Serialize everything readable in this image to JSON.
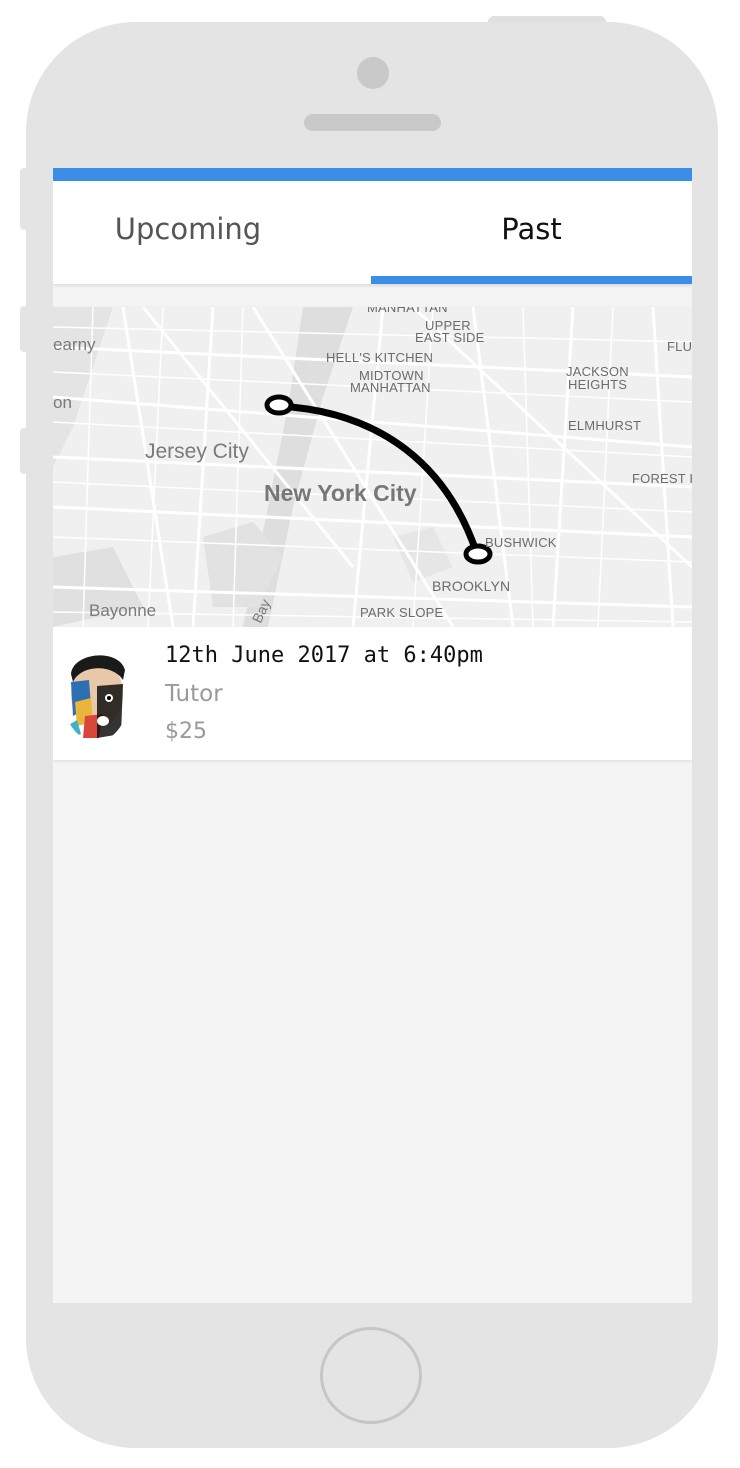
{
  "tabs": [
    {
      "label": "Upcoming",
      "active": false
    },
    {
      "label": "Past",
      "active": true
    }
  ],
  "accent_color": "#3a8ee6",
  "map": {
    "labels": {
      "manhattan": "MANHATTAN",
      "upper_east_side_1": "UPPER",
      "upper_east_side_2": "EAST SIDE",
      "kearny": "earny",
      "hells_kitchen": "HELL'S KITCHEN",
      "midtown_1": "MIDTOWN",
      "midtown_2": "MANHATTAN",
      "jackson_1": "JACKSON",
      "jackson_2": "HEIGHTS",
      "flushing": "FLUS",
      "harrison": "on",
      "jersey_city": "Jersey City",
      "elmhurst": "ELMHURST",
      "new_york_city": "New York City",
      "forest_hills": "FOREST HI",
      "bushwick": "BUSHWICK",
      "brooklyn": "BROOKLYN",
      "bayonne": "Bayonne",
      "bay": "Bay",
      "park_slope": "PARK SLOPE"
    },
    "route_icon": "curved-route-line"
  },
  "ride": {
    "date": "12th June 2017 at 6:40pm",
    "type": "Tutor",
    "price": "$25"
  }
}
